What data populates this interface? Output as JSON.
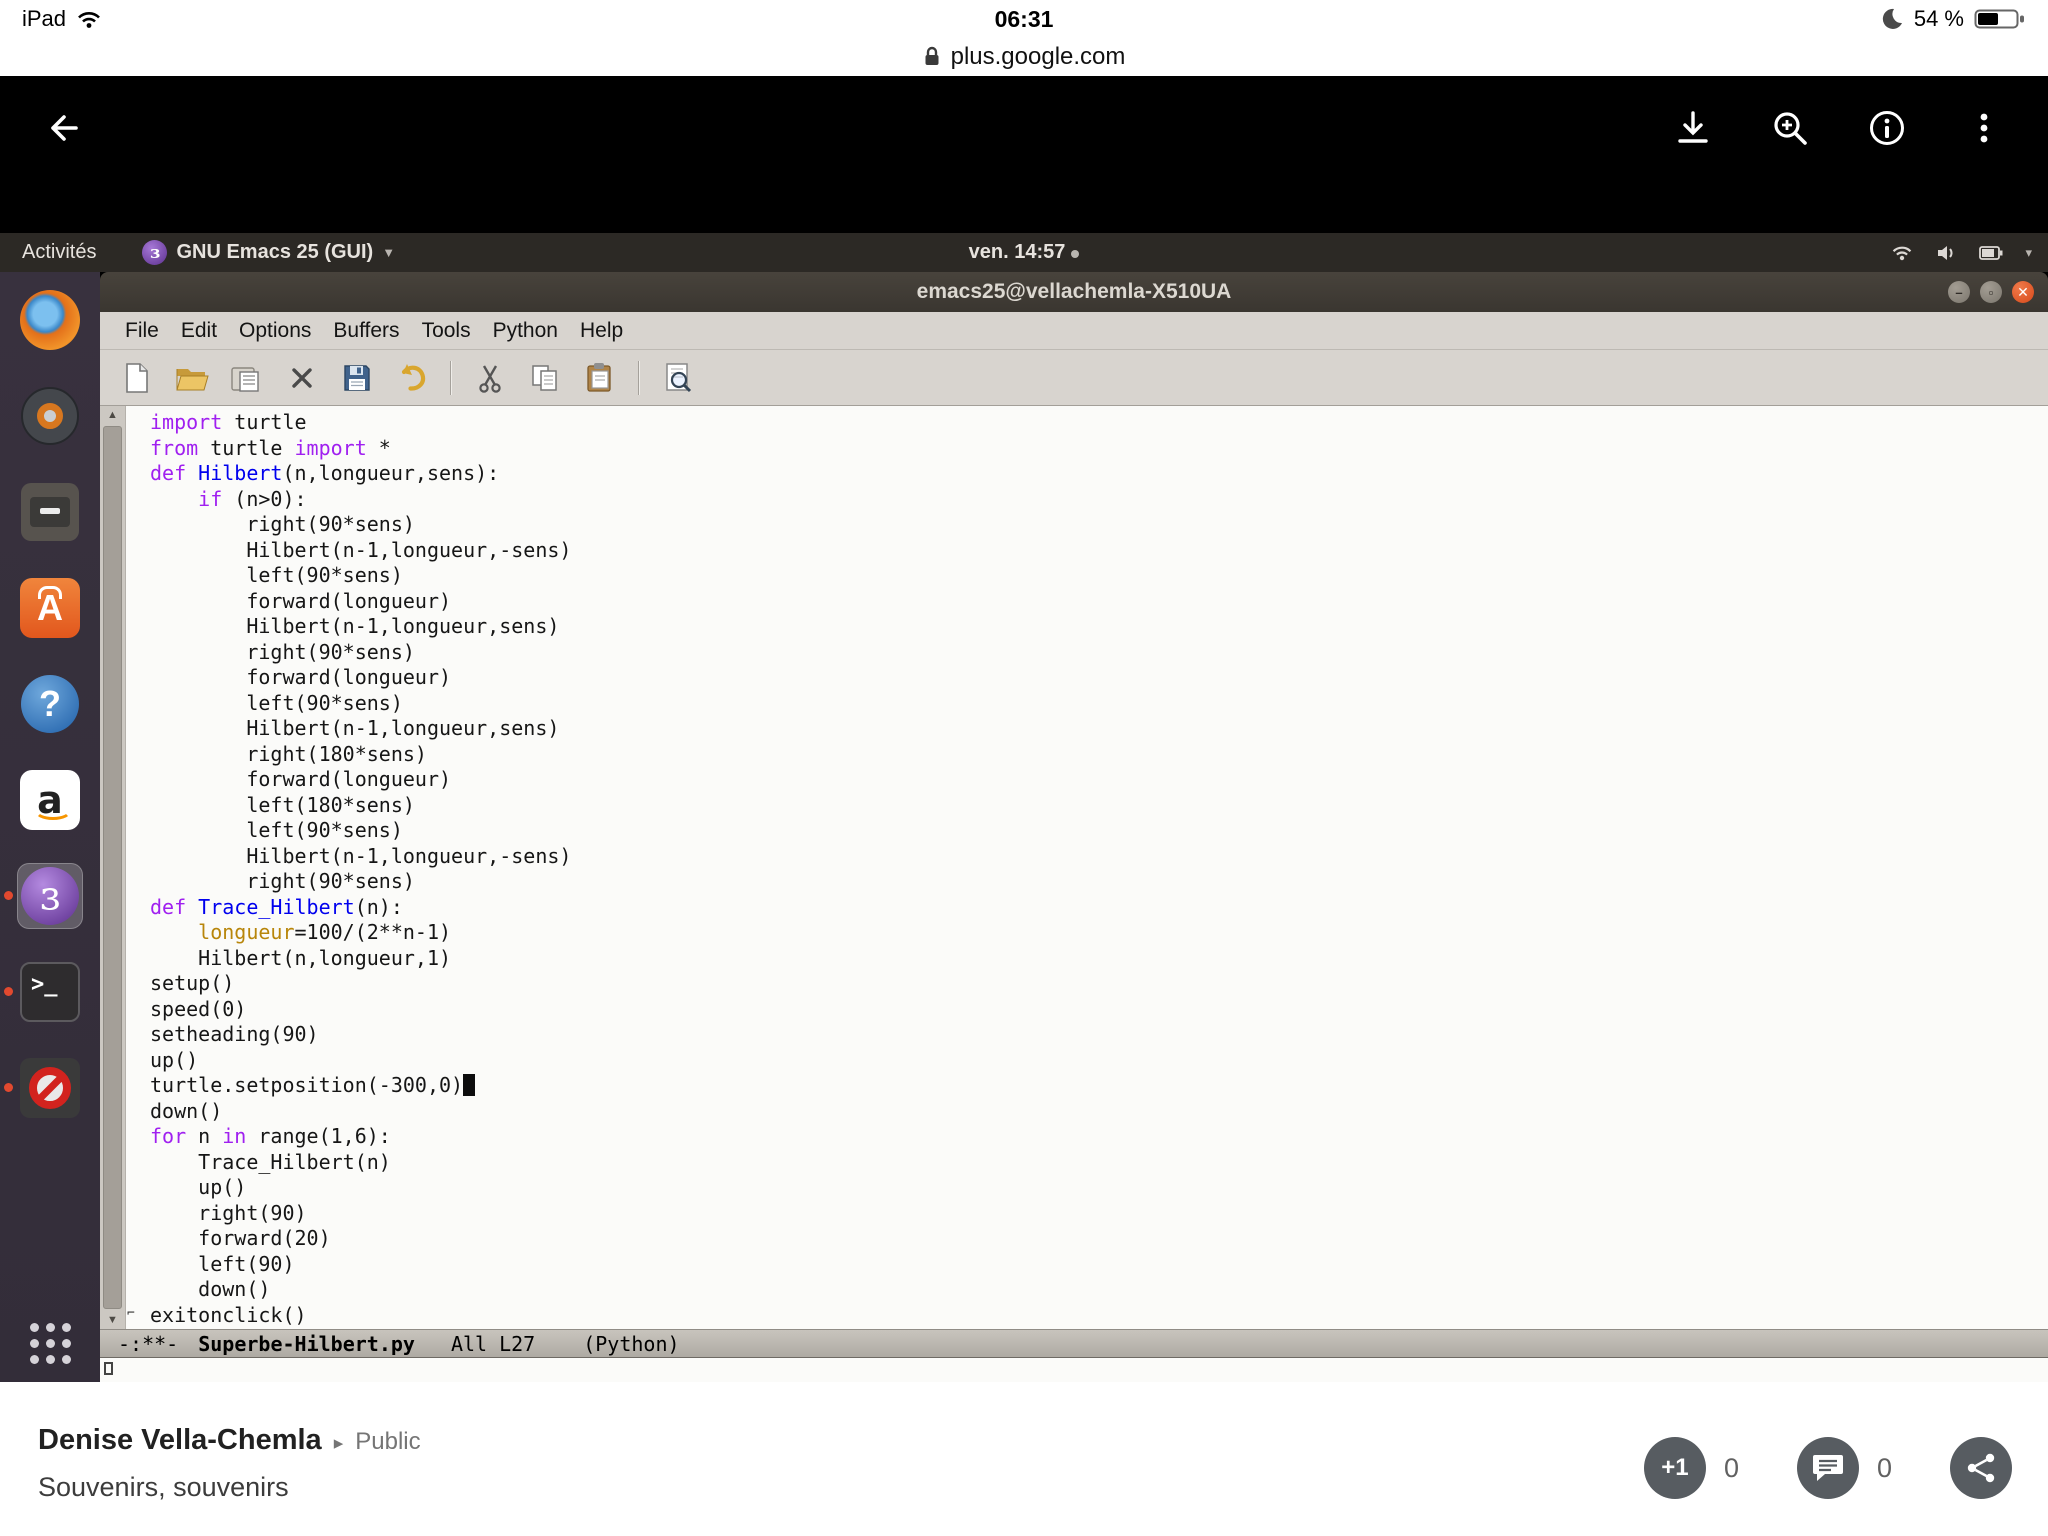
{
  "ios": {
    "carrier": "iPad",
    "time": "06:31",
    "battery_percent": "54 %",
    "url": "plus.google.com"
  },
  "ubuntu": {
    "activities": "Activités",
    "app_menu": "GNU Emacs 25 (GUI)",
    "clock": "ven. 14:57",
    "window_title": "emacs25@vellachemla-X510UA"
  },
  "launcher": {
    "items": [
      "firefox",
      "music-player",
      "file-drawer",
      "software-center",
      "help",
      "amazon",
      "emacs",
      "terminal",
      "forbidden",
      "show-applications"
    ]
  },
  "emacs": {
    "menus": [
      "File",
      "Edit",
      "Options",
      "Buffers",
      "Tools",
      "Python",
      "Help"
    ],
    "toolbar": [
      "new-file",
      "open-folder",
      "dired",
      "close-buffer",
      "save",
      "undo",
      "cut",
      "copy",
      "paste",
      "search"
    ],
    "cursor_line": 27,
    "code_lines": [
      [
        [
          "k",
          "import"
        ],
        [
          "d",
          " turtle"
        ]
      ],
      [
        [
          "k",
          "from"
        ],
        [
          "d",
          " turtle "
        ],
        [
          "k",
          "import"
        ],
        [
          "d",
          " *"
        ]
      ],
      [
        [
          "k",
          "def"
        ],
        [
          "d",
          " "
        ],
        [
          "f",
          "Hilbert"
        ],
        [
          "d",
          "(n,longueur,sens):"
        ]
      ],
      [
        [
          "d",
          "    "
        ],
        [
          "k",
          "if"
        ],
        [
          "d",
          " (n>0):"
        ]
      ],
      [
        [
          "d",
          "        right(90*sens)"
        ]
      ],
      [
        [
          "d",
          "        Hilbert(n-1,longueur,-sens)"
        ]
      ],
      [
        [
          "d",
          "        left(90*sens)"
        ]
      ],
      [
        [
          "d",
          "        forward(longueur)"
        ]
      ],
      [
        [
          "d",
          "        Hilbert(n-1,longueur,sens)"
        ]
      ],
      [
        [
          "d",
          "        right(90*sens)"
        ]
      ],
      [
        [
          "d",
          "        forward(longueur)"
        ]
      ],
      [
        [
          "d",
          "        left(90*sens)"
        ]
      ],
      [
        [
          "d",
          "        Hilbert(n-1,longueur,sens)"
        ]
      ],
      [
        [
          "d",
          "        right(180*sens)"
        ]
      ],
      [
        [
          "d",
          "        forward(longueur)"
        ]
      ],
      [
        [
          "d",
          "        left(180*sens)"
        ]
      ],
      [
        [
          "d",
          "        left(90*sens)"
        ]
      ],
      [
        [
          "d",
          "        Hilbert(n-1,longueur,-sens)"
        ]
      ],
      [
        [
          "d",
          "        right(90*sens)"
        ]
      ],
      [
        [
          "k",
          "def"
        ],
        [
          "d",
          " "
        ],
        [
          "f",
          "Trace_Hilbert"
        ],
        [
          "d",
          "(n):"
        ]
      ],
      [
        [
          "d",
          "    "
        ],
        [
          "v",
          "longueur"
        ],
        [
          "d",
          "=100/(2**n-1)"
        ]
      ],
      [
        [
          "d",
          "    Hilbert(n,longueur,1)"
        ]
      ],
      [
        [
          "d",
          "setup()"
        ]
      ],
      [
        [
          "d",
          "speed(0)"
        ]
      ],
      [
        [
          "d",
          "setheading(90)"
        ]
      ],
      [
        [
          "d",
          "up()"
        ]
      ],
      [
        [
          "d",
          "turtle.setposition(-300,0)"
        ]
      ],
      [
        [
          "d",
          "down()"
        ]
      ],
      [
        [
          "k",
          "for"
        ],
        [
          "d",
          " n "
        ],
        [
          "k",
          "in"
        ],
        [
          "d",
          " range(1,6):"
        ]
      ],
      [
        [
          "d",
          "    Trace_Hilbert(n)"
        ]
      ],
      [
        [
          "d",
          "    up()"
        ]
      ],
      [
        [
          "d",
          "    right(90)"
        ]
      ],
      [
        [
          "d",
          "    forward(20)"
        ]
      ],
      [
        [
          "d",
          "    left(90)"
        ]
      ],
      [
        [
          "d",
          "    down()"
        ]
      ],
      [
        [
          "d",
          "exitonclick()"
        ]
      ]
    ],
    "mode_line": {
      "flags": "-:**-",
      "buffer": "Superbe-Hilbert.py",
      "scroll": "All",
      "line": "L27",
      "mode": "(Python)"
    }
  },
  "post": {
    "author": "Denise Vella-Chemla",
    "separator": "▸",
    "visibility": "Public",
    "title": "Souvenirs, souvenirs",
    "plus_one": "+1",
    "plus_one_count": "0",
    "comment_count": "0"
  },
  "colors": {
    "keyword": "#a020f0",
    "function_name": "#0000ee",
    "variable": "#b8860b",
    "ubuntu_orange": "#e2571d",
    "close_button": "#d7491a",
    "launcher_bg": "#363040",
    "panel_bg": "#2c2925"
  }
}
